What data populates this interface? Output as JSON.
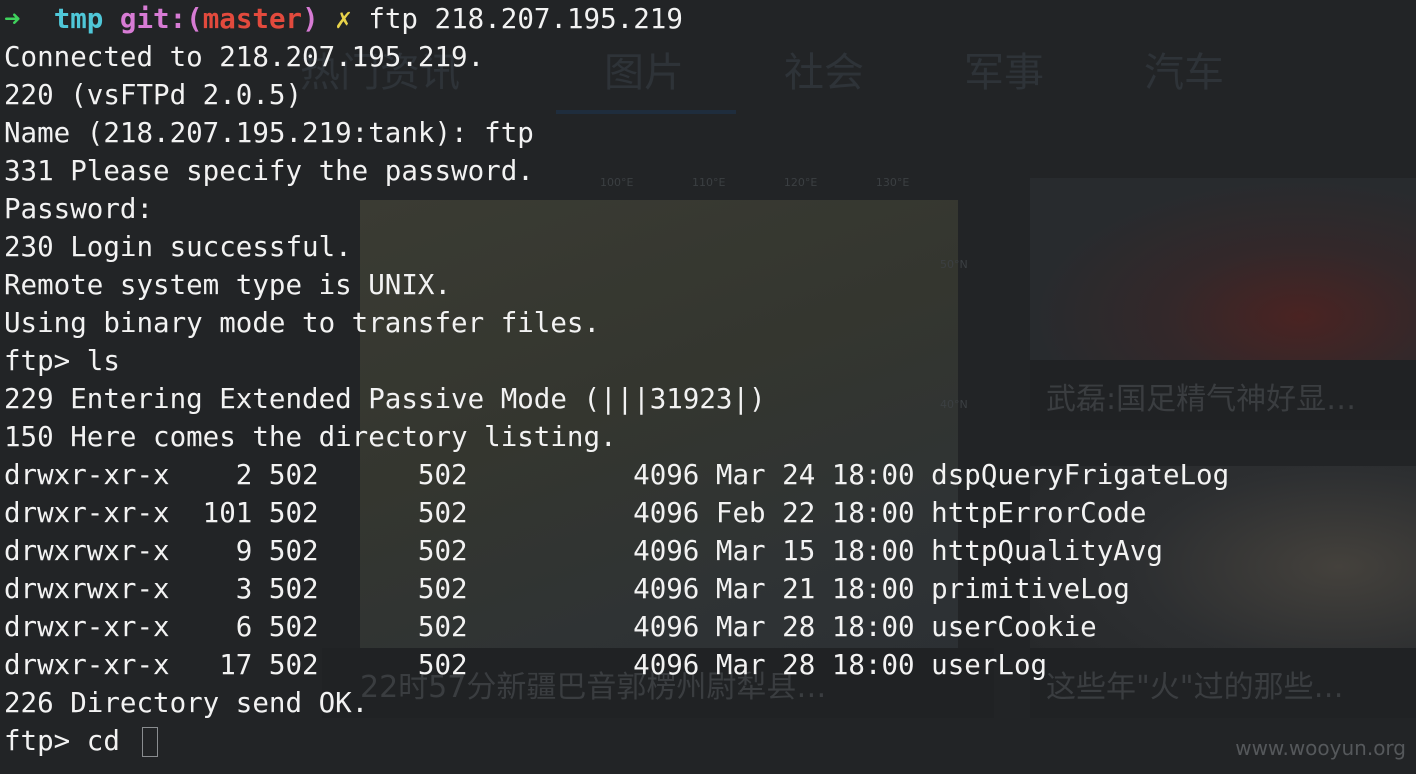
{
  "background": {
    "tabs": [
      "热门资讯",
      "图片",
      "社会",
      "军事",
      "汽车"
    ],
    "map_lon_ticks": [
      "100°E",
      "110°E",
      "120°E",
      "130°E"
    ],
    "map_lat_ticks": [
      "50°N",
      "40°N"
    ],
    "captions": [
      "武磊:国足精气神好显…",
      "22时57分新疆巴音郭楞州尉犁县…",
      "这些年\"火\"过的那些…"
    ],
    "watermark": "www.wooyun.org"
  },
  "terminal": {
    "prompt": {
      "arrow": "➜",
      "cwd": "tmp",
      "git_prefix": "git:(",
      "branch": "master",
      "git_suffix": ")",
      "dirty": "✗",
      "command": "ftp 218.207.195.219"
    },
    "output_lines": [
      "Connected to 218.207.195.219.",
      "220 (vsFTPd 2.0.5)",
      "Name (218.207.195.219:tank): ftp",
      "331 Please specify the password.",
      "Password:",
      "230 Login successful.",
      "Remote system type is UNIX.",
      "Using binary mode to transfer files.",
      "ftp> ls",
      "229 Entering Extended Passive Mode (|||31923|)",
      "150 Here comes the directory listing.",
      "drwxr-xr-x    2 502      502          4096 Mar 24 18:00 dspQueryFrigateLog",
      "drwxr-xr-x  101 502      502          4096 Feb 22 18:00 httpErrorCode",
      "drwxrwxr-x    9 502      502          4096 Mar 15 18:00 httpQualityAvg",
      "drwxrwxr-x    3 502      502          4096 Mar 21 18:00 primitiveLog",
      "drwxr-xr-x    6 502      502          4096 Mar 28 18:00 userCookie",
      "drwxr-xr-x   17 502      502          4096 Mar 28 18:00 userLog",
      "226 Directory send OK."
    ],
    "input_prompt": "ftp> ",
    "input_value": "cd "
  }
}
